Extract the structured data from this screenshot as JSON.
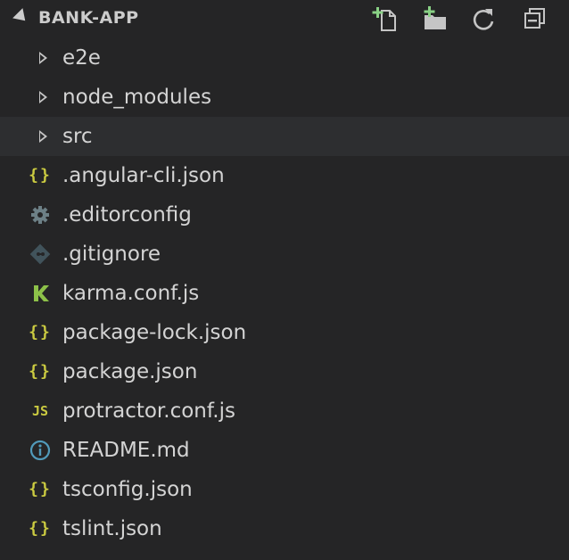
{
  "explorer": {
    "title": "BANK-APP",
    "actions": [
      {
        "name": "new-file-icon"
      },
      {
        "name": "new-folder-icon"
      },
      {
        "name": "refresh-icon"
      },
      {
        "name": "collapse-all-icon"
      }
    ],
    "items": [
      {
        "label": "e2e",
        "kind": "folder",
        "icon": "chevron-right-icon"
      },
      {
        "label": "node_modules",
        "kind": "folder",
        "icon": "chevron-right-icon"
      },
      {
        "label": "src",
        "kind": "folder",
        "icon": "chevron-right-icon",
        "selected": true
      },
      {
        "label": ".angular-cli.json",
        "kind": "file",
        "icon": "json-icon",
        "glyph": "{}"
      },
      {
        "label": ".editorconfig",
        "kind": "file",
        "icon": "gear-icon"
      },
      {
        "label": ".gitignore",
        "kind": "file",
        "icon": "git-icon"
      },
      {
        "label": "karma.conf.js",
        "kind": "file",
        "icon": "karma-icon"
      },
      {
        "label": "package-lock.json",
        "kind": "file",
        "icon": "json-icon",
        "glyph": "{}"
      },
      {
        "label": "package.json",
        "kind": "file",
        "icon": "json-icon",
        "glyph": "{}"
      },
      {
        "label": "protractor.conf.js",
        "kind": "file",
        "icon": "js-icon",
        "glyph": "JS"
      },
      {
        "label": "README.md",
        "kind": "file",
        "icon": "info-icon"
      },
      {
        "label": "tsconfig.json",
        "kind": "file",
        "icon": "json-icon",
        "glyph": "{}"
      },
      {
        "label": "tslint.json",
        "kind": "file",
        "icon": "json-icon",
        "glyph": "{}"
      }
    ]
  },
  "colors": {
    "background": "#252526",
    "text": "#d4d4d4",
    "json": "#cbcb41",
    "gear": "#6d8086",
    "git": "#41535b",
    "karma": "#8dc149",
    "info": "#519aba",
    "selected_row": "#2d2e30"
  }
}
